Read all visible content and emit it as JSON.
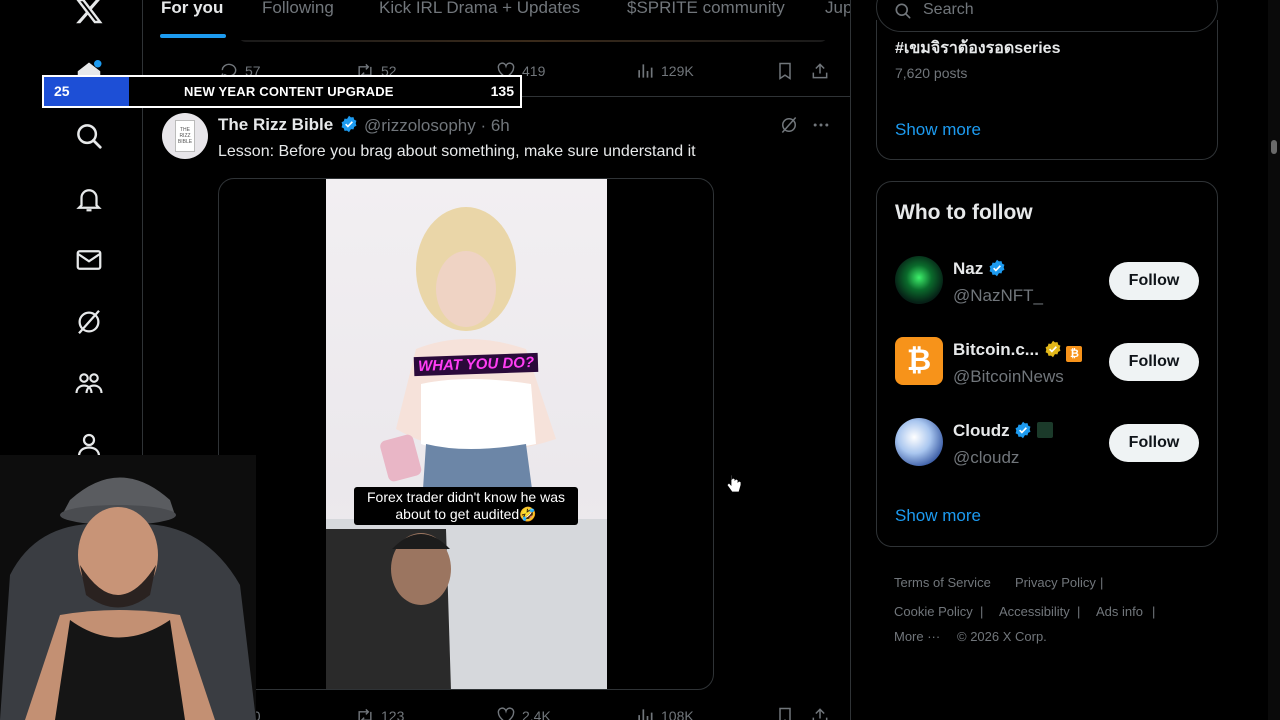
{
  "tabs": [
    {
      "label": "For you",
      "active": true
    },
    {
      "label": "Following"
    },
    {
      "label": "Kick IRL Drama + Updates"
    },
    {
      "label": "$SPRITE community"
    },
    {
      "label": "Jup"
    }
  ],
  "prev_tweet_actions": {
    "replies": "57",
    "reposts": "52",
    "likes": "419",
    "views": "129K"
  },
  "overlay_bar": {
    "left_value": "25",
    "title": "NEW YEAR CONTENT UPGRADE",
    "right_value": "135",
    "accent": "#1d4fd6"
  },
  "tweet": {
    "name": "The Rizz Bible",
    "handle_time": "@rizzolosophy · 6h",
    "text": "Lesson: Before you brag about something, make sure understand it",
    "avatar_text": "THE RIZZ BIBLE",
    "video_captions": {
      "top": "WHAT YOU DO?",
      "bottom": "Forex trader didn't know he was about to get audited🤣"
    },
    "actions": {
      "replies": "20",
      "reposts": "123",
      "likes": "2.4K",
      "views": "108K"
    }
  },
  "search": {
    "placeholder": "Search"
  },
  "trend": {
    "title": "#เขมจิราต้องรอดseries",
    "posts": "7,620 posts",
    "show_more": "Show more"
  },
  "who_to_follow": {
    "title": "Who to follow",
    "accounts": [
      {
        "name": "Naz",
        "handle": "@NazNFT_",
        "button": "Follow"
      },
      {
        "name": "Bitcoin.c...",
        "handle": "@BitcoinNews",
        "button": "Follow"
      },
      {
        "name": "Cloudz",
        "handle": "@cloudz",
        "button": "Follow"
      }
    ],
    "show_more": "Show more"
  },
  "footer": {
    "terms": "Terms of Service",
    "privacy": "Privacy Policy",
    "cookie": "Cookie Policy",
    "accessibility": "Accessibility",
    "ads": "Ads info",
    "more": "More ···",
    "copyright": "© 2026 X Corp."
  },
  "colors": {
    "accent": "#1d9bf0",
    "background": "#000000",
    "border": "#2f3336",
    "muted": "#71767b"
  }
}
